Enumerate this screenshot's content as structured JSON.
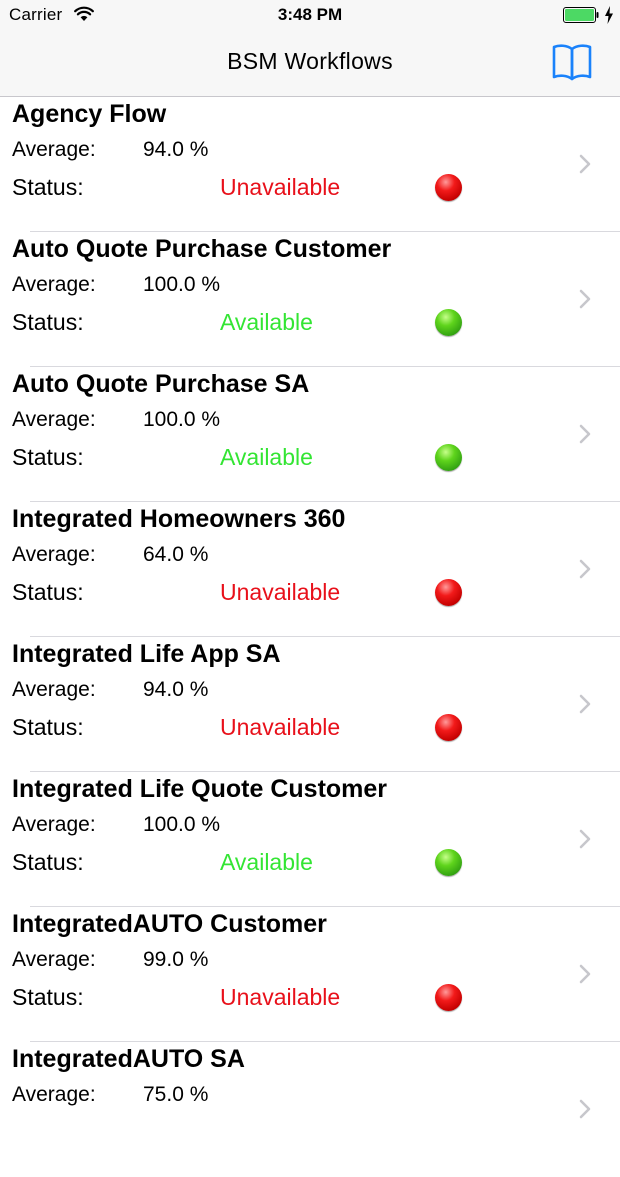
{
  "status_bar": {
    "carrier": "Carrier",
    "time": "3:48 PM",
    "icons": [
      "wifi-icon",
      "battery-icon",
      "charging-bolt-icon"
    ]
  },
  "nav": {
    "title": "BSM Workflows",
    "right_icon": "book-icon"
  },
  "labels": {
    "average": "Average:",
    "status": "Status:"
  },
  "colors": {
    "unavailable": "#e8101a",
    "available": "#33e533",
    "accent": "#1a82fb"
  },
  "workflows": [
    {
      "name": "Agency Flow",
      "average": "94.0 %",
      "status": "Unavailable",
      "state": "red"
    },
    {
      "name": "Auto Quote Purchase Customer",
      "average": "100.0 %",
      "status": "Available",
      "state": "green"
    },
    {
      "name": "Auto Quote Purchase SA",
      "average": "100.0 %",
      "status": "Available",
      "state": "green"
    },
    {
      "name": "Integrated Homeowners 360",
      "average": "64.0 %",
      "status": "Unavailable",
      "state": "red"
    },
    {
      "name": "Integrated Life App SA",
      "average": "94.0 %",
      "status": "Unavailable",
      "state": "red"
    },
    {
      "name": "Integrated Life Quote Customer",
      "average": "100.0 %",
      "status": "Available",
      "state": "green"
    },
    {
      "name": "IntegratedAUTO Customer",
      "average": "99.0 %",
      "status": "Unavailable",
      "state": "red"
    },
    {
      "name": "IntegratedAUTO SA",
      "average": "75.0 %",
      "status": "",
      "state": ""
    }
  ]
}
